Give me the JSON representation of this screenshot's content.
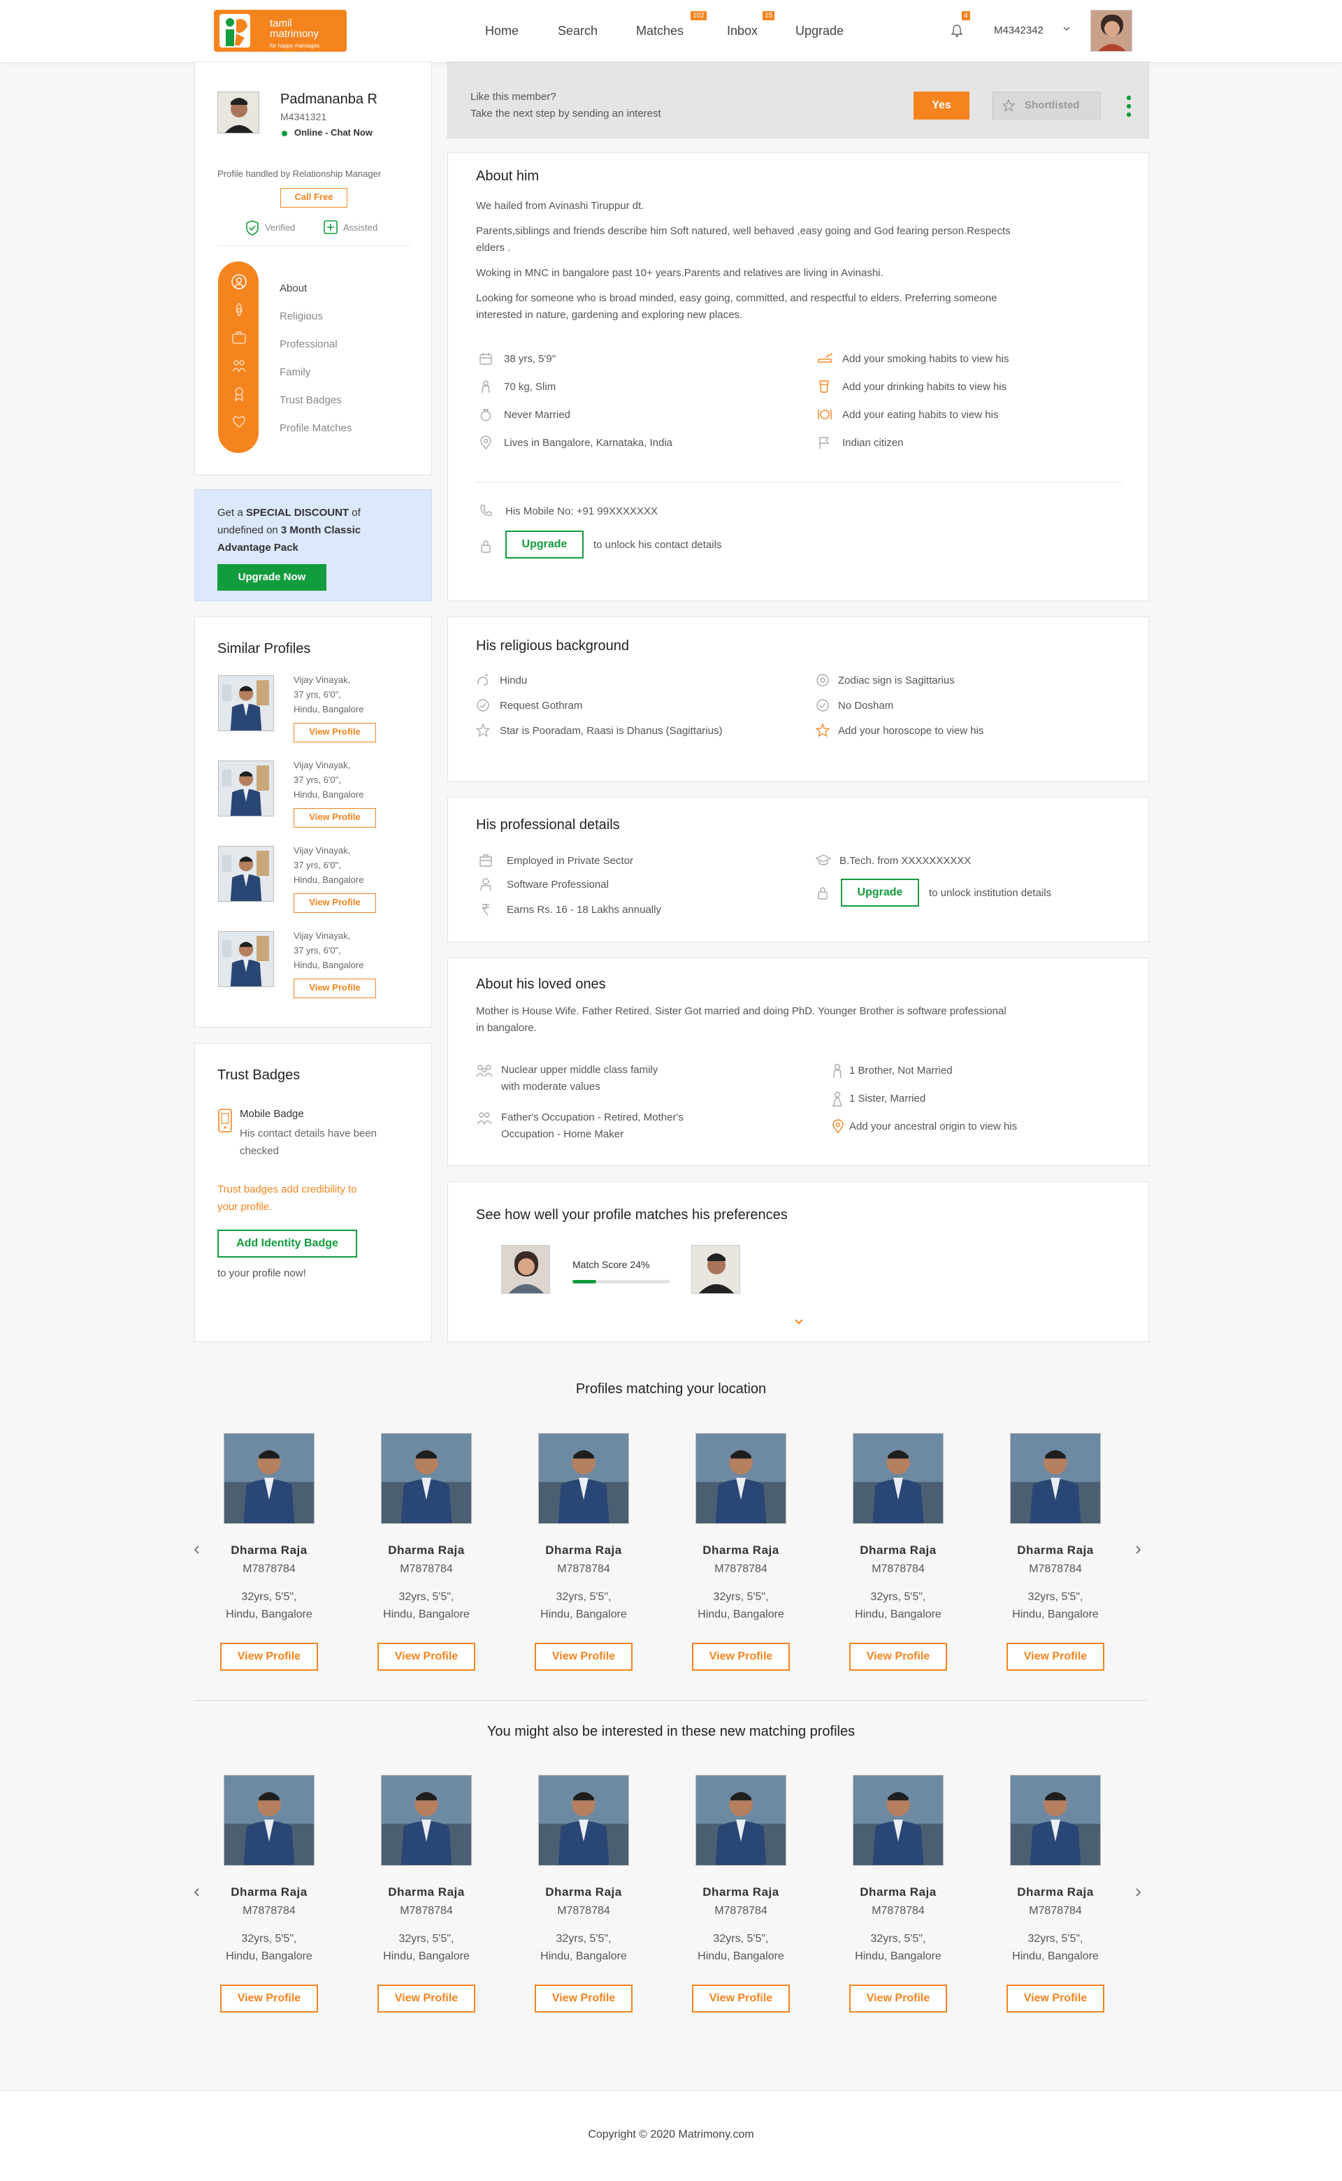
{
  "header": {
    "logo_line1": "tamil",
    "logo_line2": "matrimony",
    "logo_tagline": "for happy marriages",
    "nav": [
      {
        "label": "Home",
        "badge": ""
      },
      {
        "label": "Search",
        "badge": ""
      },
      {
        "label": "Matches",
        "badge": "102"
      },
      {
        "label": "Inbox",
        "badge": "15"
      },
      {
        "label": "Upgrade",
        "badge": ""
      }
    ],
    "notif_badge": "4",
    "user_id": "M4342342"
  },
  "profile": {
    "name": "Padmananba R",
    "id": "M4341321",
    "status": "Online - Chat Now",
    "handled_by": "Profile handled by Relationship Manager",
    "call_free": "Call Free",
    "verified": "Verified",
    "assisted": "Assisted",
    "nav": [
      "About",
      "Religious",
      "Professional",
      "Family",
      "Trust Badges",
      "Profile Matches"
    ]
  },
  "discount": {
    "line1_pre": "Get a ",
    "line1_bold": "SPECIAL DISCOUNT",
    "line1_post": " of",
    "line2_pre": "undefined on ",
    "line2_bold": "3 Month Classic",
    "line3_bold": "Advantage Pack",
    "button": "Upgrade Now"
  },
  "similar": {
    "title": "Similar Profiles",
    "items": [
      {
        "name": "Vijay Vinayak,",
        "age": "37 yrs, 6'0\",",
        "place": "Hindu, Bangalore",
        "button": "View Profile"
      },
      {
        "name": "Vijay Vinayak,",
        "age": "37 yrs, 6'0\",",
        "place": "Hindu, Bangalore",
        "button": "View Profile"
      },
      {
        "name": "Vijay Vinayak,",
        "age": "37 yrs, 6'0\",",
        "place": "Hindu, Bangalore",
        "button": "View Profile"
      },
      {
        "name": "Vijay Vinayak,",
        "age": "37 yrs, 6'0\",",
        "place": "Hindu, Bangalore",
        "button": "View Profile"
      }
    ]
  },
  "trust": {
    "title": "Trust Badges",
    "badge_name": "Mobile Badge",
    "badge_desc1": "His contact details have been",
    "badge_desc2": "checked",
    "credibility1": "Trust badges add credibility to",
    "credibility2": "your profile.",
    "button": "Add Identity Badge",
    "after": "to your profile now!"
  },
  "interest": {
    "line1": "Like this member?",
    "line2": "Take the next step by sending an interest",
    "yes": "Yes",
    "shortlisted": "Shortlisted"
  },
  "about": {
    "title": "About him",
    "p1": "We hailed from Avinashi Tiruppur dt.",
    "p2a": "Parents,siblings and friends describe him Soft natured, well behaved ,easy going and God fearing person.Respects",
    "p2b": "elders .",
    "p3": "Woking in MNC in bangalore past 10+ years.Parents and relatives are living in Avinashi.",
    "p4a": "Looking for someone who is broad minded, easy going, committed, and respectful to elders. Preferring someone",
    "p4b": "interested in nature, gardening and exploring new places.",
    "left": [
      "38 yrs, 5'9\"",
      "70 kg, Slim",
      "Never Married",
      "Lives in Bangalore, Karnataka, India"
    ],
    "right": [
      "Add your smoking habits to view his",
      "Add your drinking habits to view his",
      "Add your eating habits to view his",
      "Indian citizen"
    ],
    "mobile": "His Mobile No: +91 99XXXXXXX",
    "upgrade": "Upgrade",
    "unlock": "to unlock his contact details"
  },
  "religious": {
    "title": "His religious background",
    "left": [
      "Hindu",
      "Request Gothram",
      "Star is Pooradam, Raasi is Dhanus (Sagittarius)"
    ],
    "right": [
      "Zodiac sign is Sagittarius",
      "No Dosham",
      "Add your horoscope to view his"
    ]
  },
  "professional": {
    "title": "His professional details",
    "left": [
      "Employed in Private Sector",
      "Software Professional",
      "Earns Rs. 16 - 18 Lakhs annually"
    ],
    "education": "B.Tech. from XXXXXXXXXX",
    "upgrade": "Upgrade",
    "unlock": "to unlock institution details"
  },
  "family": {
    "title": "About his loved ones",
    "p1a": "Mother is House Wife. Father Retired. Sister Got married and doing PhD. Younger Brother is software professional",
    "p1b": "in bangalore.",
    "left1a": "Nuclear upper middle class family",
    "left1b": "with moderate values",
    "left2a": "Father's Occupation - Retired, Mother's",
    "left2b": "Occupation - Home Maker",
    "right": [
      "1 Brother, Not Married",
      "1 Sister, Married",
      "Add your ancestral origin to view his"
    ]
  },
  "match": {
    "title": "See how well your profile matches his preferences",
    "score_label": "Match Score 24%",
    "score": 0.24
  },
  "location": {
    "title": "Profiles matching your location",
    "items": [
      {
        "name": "Dharma Raja",
        "id": "M7878784",
        "age": "32yrs, 5'5\",",
        "place": "Hindu, Bangalore",
        "button": "View Profile"
      },
      {
        "name": "Dharma Raja",
        "id": "M7878784",
        "age": "32yrs, 5'5\",",
        "place": "Hindu, Bangalore",
        "button": "View Profile"
      },
      {
        "name": "Dharma Raja",
        "id": "M7878784",
        "age": "32yrs, 5'5\",",
        "place": "Hindu, Bangalore",
        "button": "View Profile"
      },
      {
        "name": "Dharma Raja",
        "id": "M7878784",
        "age": "32yrs, 5'5\",",
        "place": "Hindu, Bangalore",
        "button": "View Profile"
      },
      {
        "name": "Dharma Raja",
        "id": "M7878784",
        "age": "32yrs, 5'5\",",
        "place": "Hindu, Bangalore",
        "button": "View Profile"
      },
      {
        "name": "Dharma Raja",
        "id": "M7878784",
        "age": "32yrs, 5'5\",",
        "place": "Hindu, Bangalore",
        "button": "View Profile"
      }
    ]
  },
  "newmatches": {
    "title": "You might also be interested in these new matching profiles",
    "items": [
      {
        "name": "Dharma Raja",
        "id": "M7878784",
        "age": "32yrs, 5'5\",",
        "place": "Hindu, Bangalore",
        "button": "View Profile"
      },
      {
        "name": "Dharma Raja",
        "id": "M7878784",
        "age": "32yrs, 5'5\",",
        "place": "Hindu, Bangalore",
        "button": "View Profile"
      },
      {
        "name": "Dharma Raja",
        "id": "M7878784",
        "age": "32yrs, 5'5\",",
        "place": "Hindu, Bangalore",
        "button": "View Profile"
      },
      {
        "name": "Dharma Raja",
        "id": "M7878784",
        "age": "32yrs, 5'5\",",
        "place": "Hindu, Bangalore",
        "button": "View Profile"
      },
      {
        "name": "Dharma Raja",
        "id": "M7878784",
        "age": "32yrs, 5'5\",",
        "place": "Hindu, Bangalore",
        "button": "View Profile"
      },
      {
        "name": "Dharma Raja",
        "id": "M7878784",
        "age": "32yrs, 5'5\",",
        "place": "Hindu, Bangalore",
        "button": "View Profile"
      }
    ]
  },
  "footer": {
    "copyright": "Copyright © 2020 Matrimony.com"
  },
  "colors": {
    "brand_orange": "#f5841f",
    "brand_green": "#129c3e",
    "discount_bg": "#dce8fb",
    "interest_bg": "#e5e5e5"
  }
}
